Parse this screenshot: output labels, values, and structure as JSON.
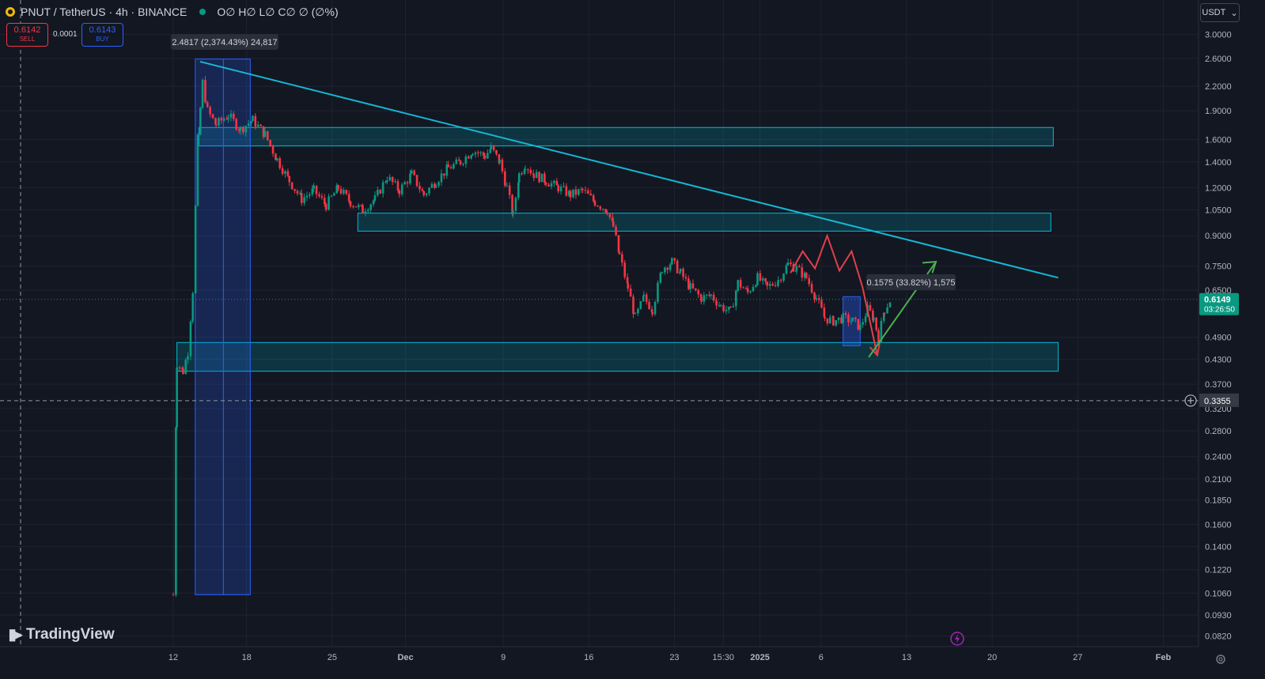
{
  "header": {
    "symbol": "PNUT / TetherUS · 4h · BINANCE",
    "ohlc": "O∅ H∅ L∅ C∅ ∅ (∅%)"
  },
  "trade": {
    "sell_price": "0.6142",
    "sell_label": "SELL",
    "spread": "0.0001",
    "buy_price": "0.6143",
    "buy_label": "BUY"
  },
  "currency": "USDT",
  "logo_text": "TradingView",
  "chart_data": {
    "type": "candlestick",
    "scale": "log",
    "ylim": [
      0.077,
      3.2
    ],
    "y_ticks": [
      "3.0000",
      "2.6000",
      "2.2000",
      "1.9000",
      "1.6000",
      "1.4000",
      "1.2000",
      "1.0500",
      "0.9000",
      "0.7500",
      "0.6500",
      "0.4900",
      "0.4300",
      "0.3700",
      "0.3200",
      "0.2800",
      "0.2400",
      "0.2100",
      "0.1850",
      "0.1600",
      "0.1400",
      "0.1220",
      "0.1060",
      "0.0930",
      "0.0820"
    ],
    "x_ticks": [
      "12",
      "18",
      "25",
      "Dec",
      "9",
      "16",
      "23",
      "15:30",
      "2025",
      "6",
      "13",
      "20",
      "27",
      "Feb"
    ],
    "last_price": "0.6149",
    "countdown": "03:26:50",
    "crosshair_price": "0.3355",
    "colors": {
      "up": "#089981",
      "down": "#f23645",
      "background": "#131722",
      "grid": "#1f2330",
      "zone": "#00bcd4",
      "trendline": "#14b8d4",
      "measure": "#2962ff",
      "arrow_down": "#e0404a",
      "arrow_up": "#4caf50"
    },
    "price_path": [
      [
        12.0,
        0.105
      ],
      [
        12.3,
        0.42
      ],
      [
        12.8,
        0.4
      ],
      [
        13.2,
        0.45
      ],
      [
        13.6,
        0.65
      ],
      [
        14.0,
        1.6
      ],
      [
        14.4,
        2.25
      ],
      [
        14.8,
        1.9
      ],
      [
        15.5,
        1.75
      ],
      [
        16.5,
        1.85
      ],
      [
        17.5,
        1.7
      ],
      [
        18.5,
        1.8
      ],
      [
        19.5,
        1.65
      ],
      [
        20.5,
        1.42
      ],
      [
        21.5,
        1.25
      ],
      [
        22.5,
        1.12
      ],
      [
        23.5,
        1.18
      ],
      [
        24.5,
        1.08
      ],
      [
        25.5,
        1.2
      ],
      [
        26.5,
        1.1
      ],
      [
        27.5,
        1.05
      ],
      [
        28.5,
        1.12
      ],
      [
        29.5,
        1.28
      ],
      [
        30.5,
        1.18
      ],
      [
        31.5,
        1.3
      ],
      [
        32.5,
        1.15
      ],
      [
        33.5,
        1.25
      ],
      [
        34.5,
        1.35
      ],
      [
        35.5,
        1.4
      ],
      [
        36.5,
        1.5
      ],
      [
        37.5,
        1.45
      ],
      [
        38.0,
        1.52
      ],
      [
        38.7,
        1.4
      ],
      [
        39.3,
        1.2
      ],
      [
        39.8,
        1.02
      ],
      [
        40.3,
        1.3
      ],
      [
        40.8,
        1.38
      ],
      [
        41.5,
        1.3
      ],
      [
        42.5,
        1.25
      ],
      [
        43.5,
        1.2
      ],
      [
        44.5,
        1.15
      ],
      [
        45.5,
        1.18
      ],
      [
        46.5,
        1.1
      ],
      [
        47.5,
        1.05
      ],
      [
        48.0,
        0.95
      ],
      [
        48.5,
        0.8
      ],
      [
        49.2,
        0.66
      ],
      [
        49.8,
        0.55
      ],
      [
        50.5,
        0.62
      ],
      [
        51.2,
        0.58
      ],
      [
        52.0,
        0.74
      ],
      [
        52.8,
        0.77
      ],
      [
        53.5,
        0.72
      ],
      [
        54.3,
        0.66
      ],
      [
        55.2,
        0.62
      ],
      [
        56.0,
        0.63
      ],
      [
        56.8,
        0.59
      ],
      [
        57.6,
        0.57
      ],
      [
        58.2,
        0.68
      ],
      [
        59.0,
        0.64
      ],
      [
        59.8,
        0.7
      ],
      [
        60.6,
        0.66
      ],
      [
        61.5,
        0.69
      ],
      [
        62.3,
        0.76
      ],
      [
        63.0,
        0.74
      ],
      [
        63.8,
        0.7
      ],
      [
        64.6,
        0.62
      ],
      [
        65.3,
        0.55
      ],
      [
        66.0,
        0.54
      ],
      [
        66.8,
        0.55
      ],
      [
        67.6,
        0.54
      ],
      [
        68.2,
        0.52
      ],
      [
        68.8,
        0.58
      ],
      [
        69.3,
        0.55
      ],
      [
        69.7,
        0.49
      ],
      [
        70.2,
        0.58
      ],
      [
        70.7,
        0.615
      ]
    ]
  },
  "annotations": {
    "big_measure": "2.4817 (2,374.43%) 24,817",
    "small_measure": "0.1575 (33.82%) 1,575"
  }
}
